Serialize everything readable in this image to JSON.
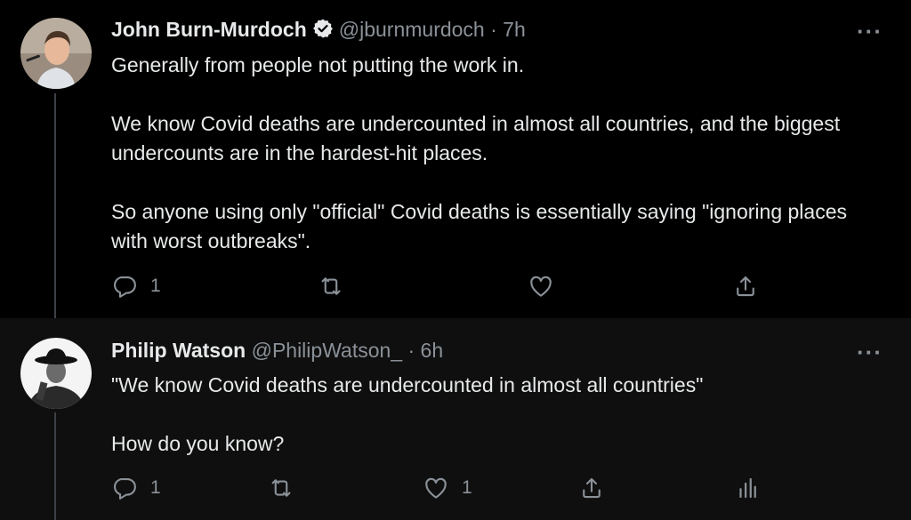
{
  "tweets": [
    {
      "author": {
        "name": "John Burn-Murdoch",
        "handle": "@jburnmurdoch",
        "verified": true
      },
      "time": "· 7h",
      "more": "···",
      "paragraphs": [
        "Generally from people not putting the work in.",
        "We know Covid deaths are undercounted in almost all countries, and the biggest undercounts are in the hardest-hit places.",
        "So anyone using only \"official\" Covid deaths is essentially saying \"ignoring places with worst outbreaks\"."
      ],
      "actions": {
        "reply_count": "1",
        "retweet_count": "",
        "like_count": ""
      }
    },
    {
      "author": {
        "name": "Philip Watson",
        "handle": "@PhilipWatson_",
        "verified": false
      },
      "time": "· 6h",
      "more": "···",
      "paragraphs": [
        "\"We know Covid deaths are undercounted in almost all countries\"",
        "How do you know?"
      ],
      "actions": {
        "reply_count": "1",
        "retweet_count": "",
        "like_count": "1"
      }
    }
  ],
  "colors": {
    "background": "#000000",
    "reply_background": "#0f0f0f",
    "text": "#e7e9ea",
    "muted": "#8b9198",
    "thread_line": "#3d4146"
  }
}
